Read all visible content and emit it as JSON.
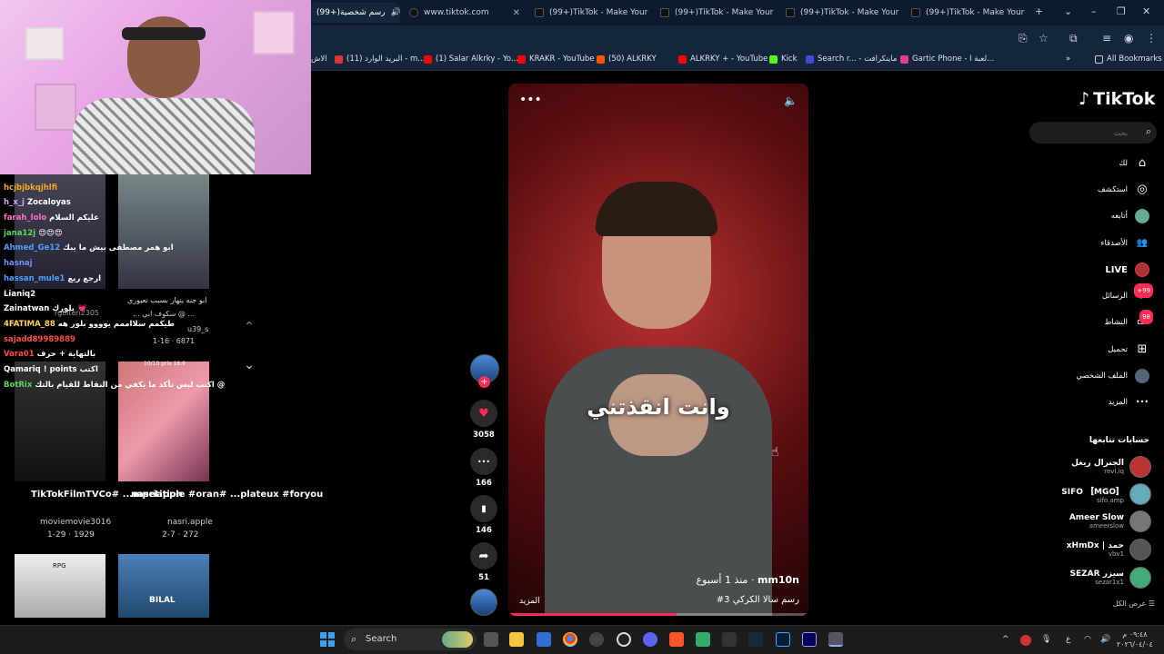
{
  "browser": {
    "tabs": [
      {
        "label": "(99+)رسم شخصية",
        "active": true
      },
      {
        "label": "www.tiktok.com",
        "active": false
      },
      {
        "label": "(99+)TikTok - Make Your",
        "active": false
      },
      {
        "label": "(99+)TikTok - Make Your",
        "active": false
      },
      {
        "label": "(99+)TikTok - Make Your",
        "active": false
      },
      {
        "label": "(99+)TikTok - Make Your",
        "active": false
      }
    ],
    "new_tab": "+",
    "window_controls": {
      "chevron": "⌄",
      "minimize": "–",
      "restore": "❐",
      "close": "✕"
    },
    "bookmarks": [
      {
        "label": "الاش",
        "color": "#777777"
      },
      {
        "label": "البريد الوارد (11) - m...",
        "color": "#d33"
      },
      {
        "label": "(1) Salar Alkrky - Yo...",
        "color": "#f00"
      },
      {
        "label": "KRAKR - YouTube",
        "color": "#f00"
      },
      {
        "label": "(50) ALKRKY",
        "color": "#ff5500"
      },
      {
        "label": "ALKRKY + - YouTube",
        "color": "#f00"
      },
      {
        "label": "Kick",
        "color": "#53fc18"
      },
      {
        "label": "Search r... - ماينكرافت",
        "color": "#4447d8"
      },
      {
        "label": "Gartic Phone - لعبة ا...",
        "color": "#e13f8c"
      }
    ],
    "more_bookmarks": "»",
    "all_bookmarks": "All Bookmarks"
  },
  "chat": [
    {
      "user": "hcjbjbkqjhlfi",
      "msg": "",
      "color": "#f5a623"
    },
    {
      "user": "h_x_j",
      "msg": "Zocaloyas",
      "color": "#cfa8ff"
    },
    {
      "user": "farah_lolo",
      "msg": "عليكم السلام",
      "color": "#ff6ec7"
    },
    {
      "user": "jana12j",
      "msg": "😍😍😍",
      "color": "#5cd65c"
    },
    {
      "user": "Ahmed_Ge12",
      "msg": "ابو همر مصطفى بيش ما يبك",
      "color": "#4ea1ff"
    },
    {
      "user": "hasnaj",
      "msg": "",
      "color": "#7b8cff"
    },
    {
      "user": "hassan_mule1",
      "msg": "ارجع ريع",
      "color": "#4ea1ff"
    },
    {
      "user": "Lianiq2",
      "msg": "",
      "color": "#ffffff"
    },
    {
      "user": "Zainatwan",
      "msg": "بلورك 💗",
      "color": "#ffffff"
    },
    {
      "user": "4FATIMA_88",
      "msg": "طيكمم سلااممم يوووو بلور هه",
      "color": "#ffd24d"
    },
    {
      "user": "sajadd89989889",
      "msg": "",
      "color": "#ff4d4d"
    },
    {
      "user": "Vara01",
      "msg": "بالتهاية + حرف",
      "color": "#ff4d4d"
    },
    {
      "user": "Qamariq",
      "msg": "! points اكتب",
      "color": "#ffffff"
    },
    {
      "user": "BotRix",
      "msg": "اكتب لبس تأكد ما يكفي من النقاط للقيام بالتك @",
      "color": "#5cd65c"
    }
  ],
  "feed": {
    "thumb1_overlay": "ابو جنه يتهار بسبب تعيوري",
    "thumb1_sub": "... سكوف ابي @ ...",
    "thumb1_user": "u39_s",
    "thumb1_stats": "1-16 · 6871",
    "thumb1_left_user": "rguiten2305",
    "item_b_caption": "TikTokFilmTVCo# ...mpetition",
    "item_b_user": "moviemovie3016",
    "item_b_stats": "1-29 · 1929",
    "item_c_caption": "nasriapple #oran# ...plateux #foryou",
    "item_c_user": "nasri.apple",
    "item_c_stats": "2-7 · 272",
    "item_c_tag": "10/10 prix 16.9",
    "thumb_rpg": "RPG",
    "thumb_bilal": "BILAL",
    "nav_up": "⌃",
    "nav_down": "⌄"
  },
  "video": {
    "caption_text": "وانت انقذتني",
    "username": "mm10n",
    "time": "منذ 1 أسبوع",
    "description": "#3 رسم سالا الكركي",
    "more": "المزيد",
    "menu": "•••",
    "sound": "🔈",
    "progress": 0.56
  },
  "actions": {
    "follow_plus": "+",
    "like_icon": "♥",
    "likes": "3058",
    "comment_icon": "•••",
    "comments": "166",
    "save_icon": "▮",
    "saves": "146",
    "share_icon": "➦",
    "shares": "51"
  },
  "sidebar": {
    "logo": "TikTok",
    "logo_note": "♪",
    "search_placeholder": "بحث",
    "search_icon": "⌕",
    "nav": [
      {
        "label": "لك",
        "icon": "⌂"
      },
      {
        "label": "استكشف",
        "icon": "◎"
      },
      {
        "label": "أتابعه",
        "icon": ""
      },
      {
        "label": "الأصدقاء",
        "icon": "👥"
      },
      {
        "label": "LIVE",
        "icon": ""
      },
      {
        "label": "الرسائل",
        "icon": "✈",
        "badge": "+99"
      },
      {
        "label": "النشاط",
        "icon": "▭",
        "badge": "98"
      },
      {
        "label": "تحميل",
        "icon": "⊞"
      },
      {
        "label": "الملف الشخصي",
        "icon": ""
      },
      {
        "label": "المزيد",
        "icon": "•••"
      }
    ],
    "following_title": "حسابات تتابعها",
    "following": [
      {
        "name": "الجنرال ريغل",
        "handle": "revl.iq",
        "color": "#b33"
      },
      {
        "name": "SIFO 〚MGO〛",
        "handle": "sifo.amp",
        "color": "#6ab"
      },
      {
        "name": "Ameer Slow",
        "handle": "ameerslow",
        "color": "#777"
      },
      {
        "name": "xHmDx | حمد",
        "handle": "vbv1",
        "color": "#555"
      },
      {
        "name": "SEZAR سيزر",
        "handle": "sezar1x1",
        "color": "#4a7"
      }
    ],
    "see_all": "عرض الكل"
  },
  "taskbar": {
    "search_label": "Search",
    "search_icon": "⌕",
    "tray_chevron": "^",
    "tray_lang": "ع",
    "time": "٠٩:٤٨ م",
    "date": "٢٠٢٦/٠٤/٠٤"
  }
}
